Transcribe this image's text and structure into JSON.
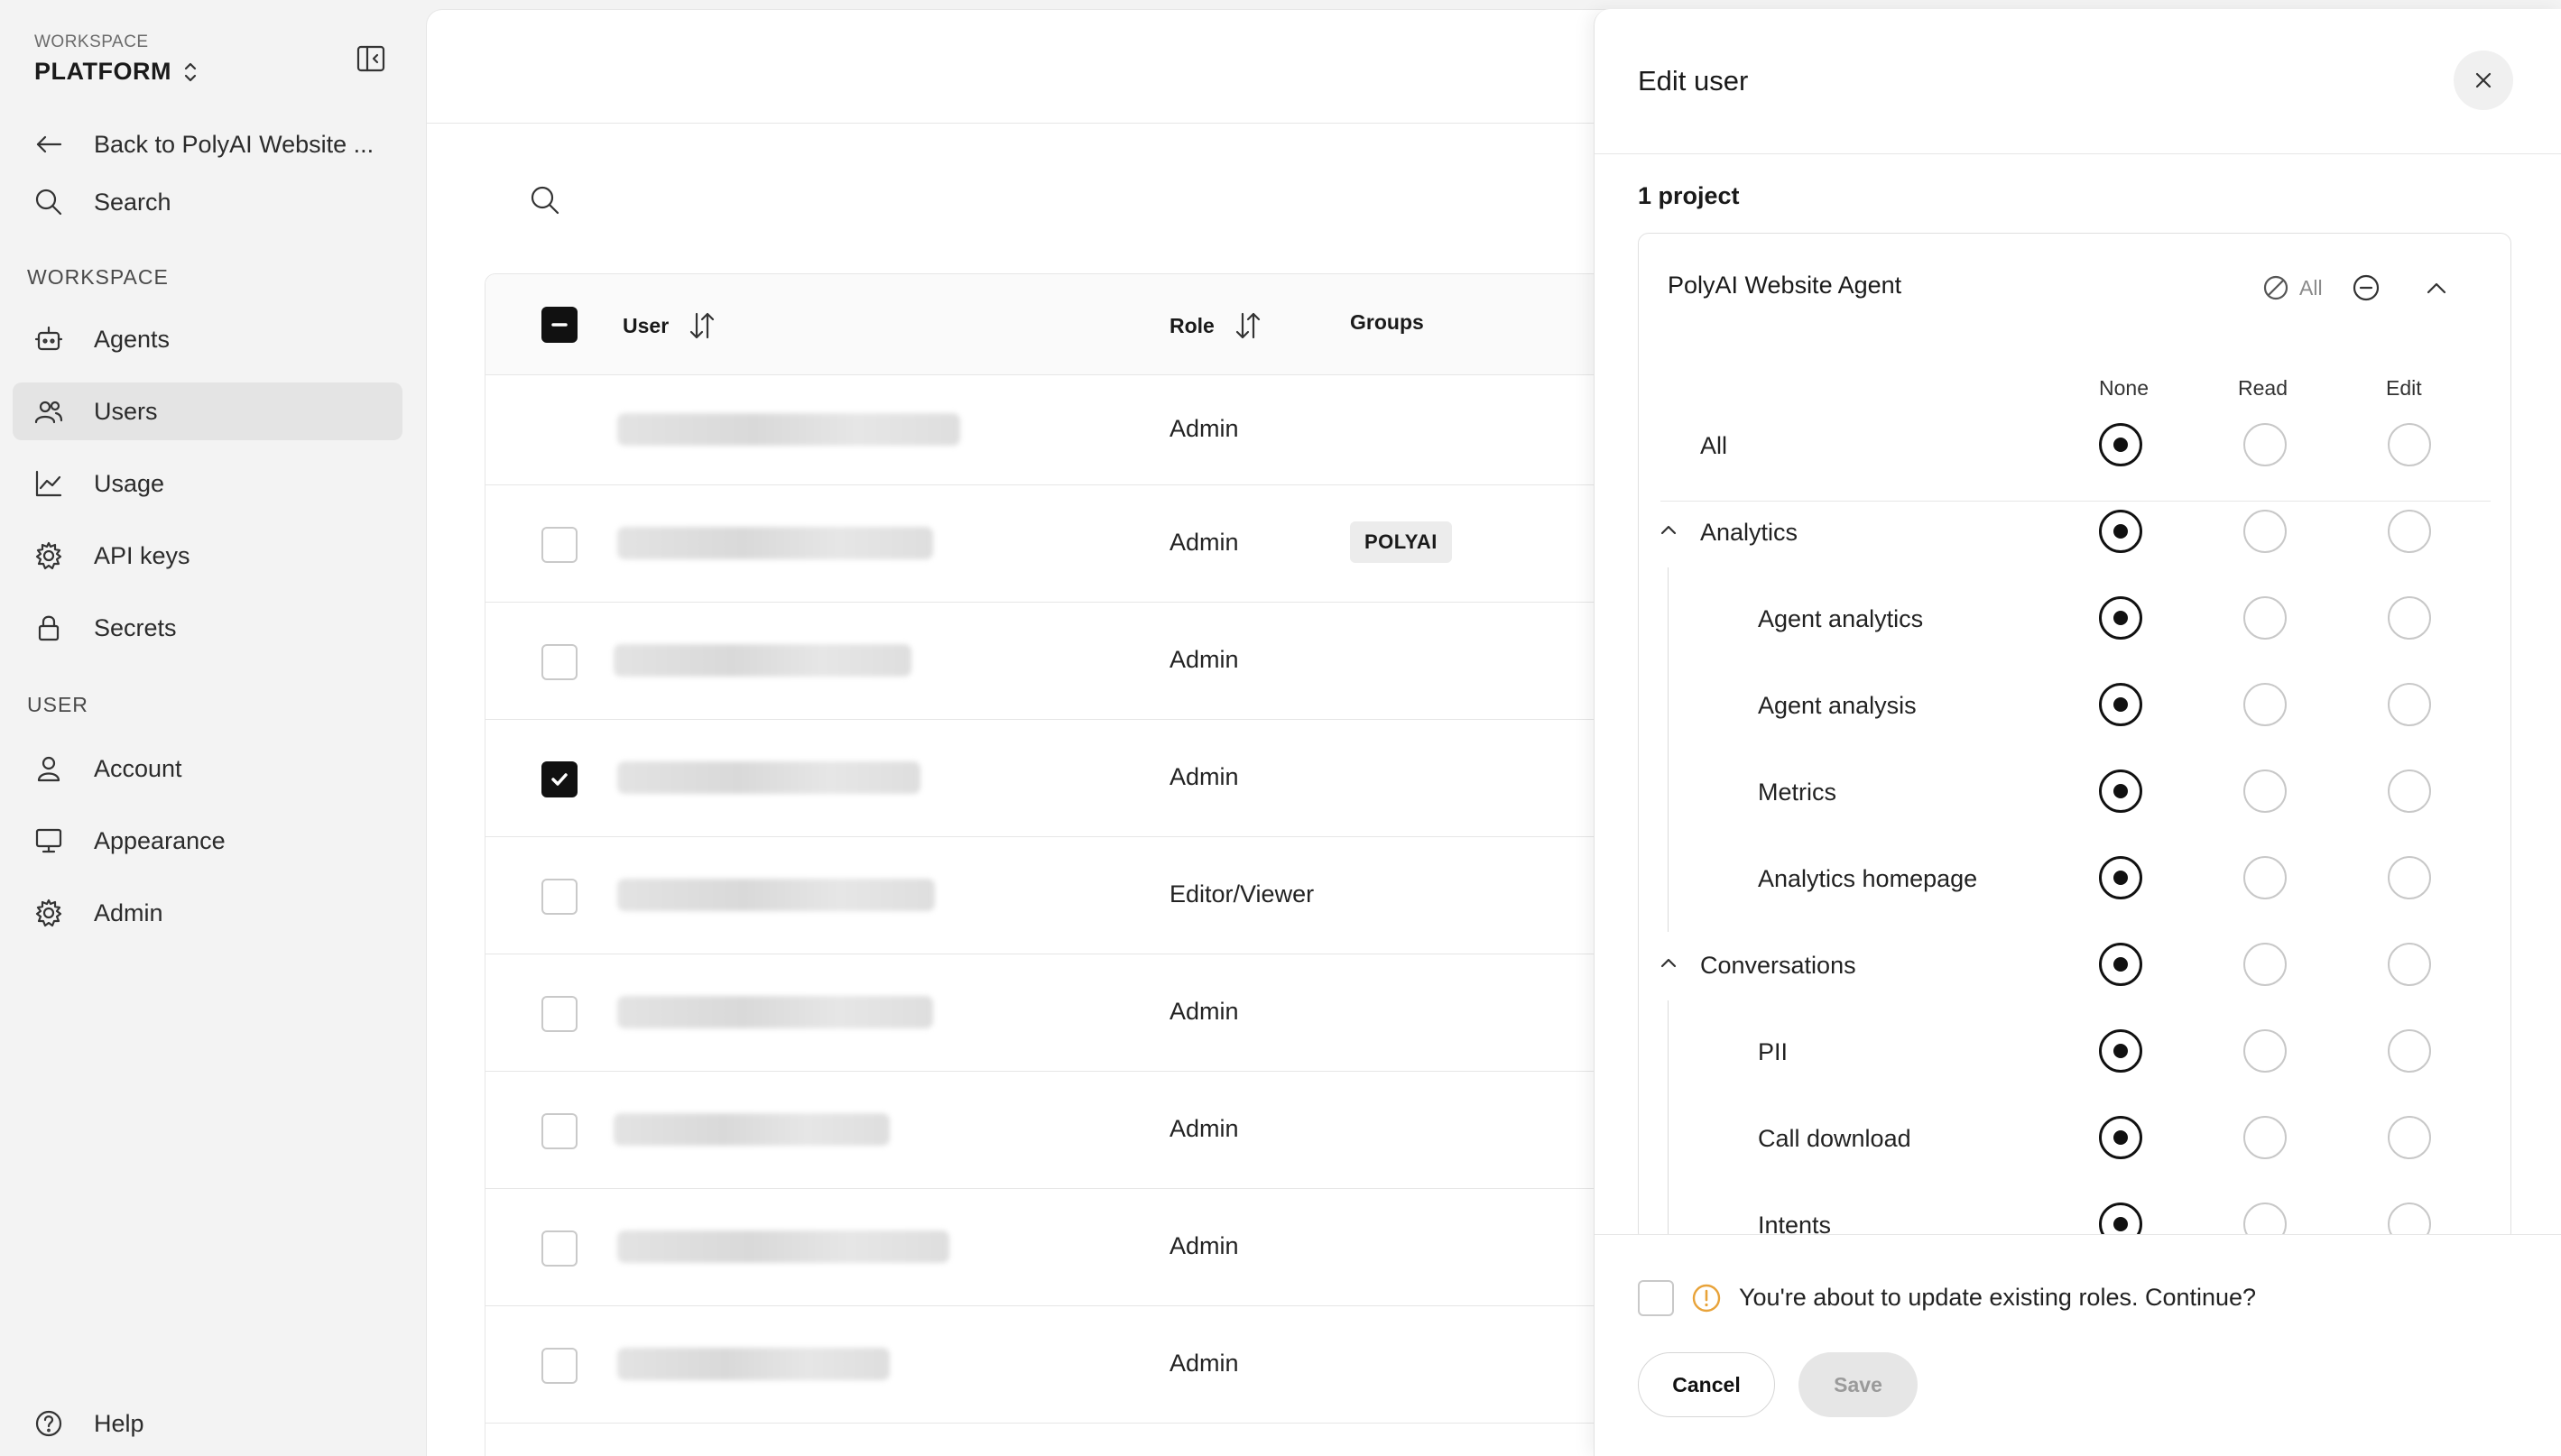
{
  "sidebar": {
    "workspace_small": "WORKSPACE",
    "workspace_name": "PLATFORM",
    "back_label": "Back to PolyAI Website ...",
    "search_label": "Search",
    "section_workspace": "WORKSPACE",
    "section_user": "USER",
    "items": [
      {
        "label": "Agents"
      },
      {
        "label": "Users"
      },
      {
        "label": "Usage"
      },
      {
        "label": "API keys"
      },
      {
        "label": "Secrets"
      },
      {
        "label": "Account"
      },
      {
        "label": "Appearance"
      },
      {
        "label": "Admin"
      }
    ],
    "help_label": "Help"
  },
  "table": {
    "headers": {
      "user": "User",
      "role": "Role",
      "groups": "Groups"
    },
    "rows": [
      {
        "role": "Admin",
        "group": ""
      },
      {
        "role": "Admin",
        "group": "POLYAI"
      },
      {
        "role": "Admin",
        "group": ""
      },
      {
        "role": "Admin",
        "group": ""
      },
      {
        "role": "Editor/Viewer",
        "group": ""
      },
      {
        "role": "Admin",
        "group": ""
      },
      {
        "role": "Admin",
        "group": ""
      },
      {
        "role": "Admin",
        "group": ""
      },
      {
        "role": "Admin",
        "group": ""
      }
    ]
  },
  "drawer": {
    "title": "Edit user",
    "project_count": "1 project",
    "project_name": "PolyAI Website Agent",
    "all_label": "All",
    "columns": {
      "none": "None",
      "read": "Read",
      "edit": "Edit"
    },
    "permissions": {
      "all": "All",
      "analytics": "Analytics",
      "agent_analytics": "Agent analytics",
      "agent_analysis": "Agent analysis",
      "metrics": "Metrics",
      "analytics_homepage": "Analytics homepage",
      "conversations": "Conversations",
      "pii": "PII",
      "call_download": "Call download",
      "intents": "Intents"
    },
    "warning_text": "You're about to update existing roles. Continue?",
    "cancel_label": "Cancel",
    "save_label": "Save"
  },
  "colors": {
    "warning": "#e8a33a",
    "active_nav": "#e4e4e4",
    "checkbox_checked": "#111111"
  }
}
